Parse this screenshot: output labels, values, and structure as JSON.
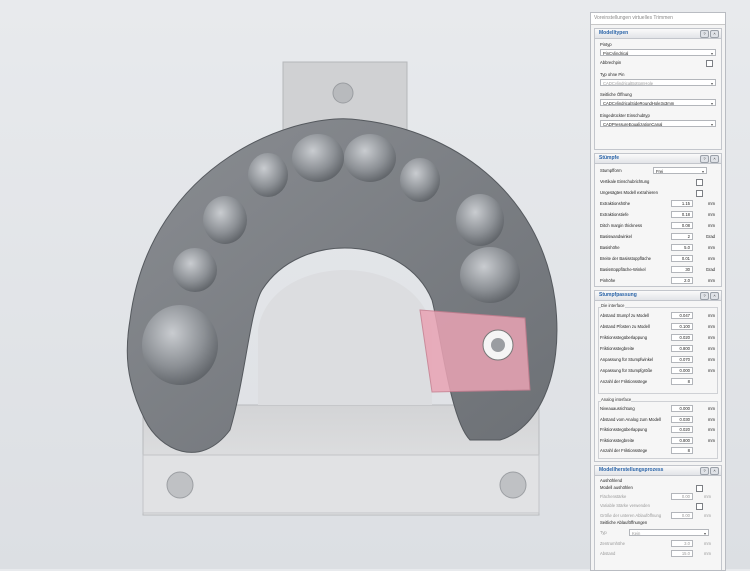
{
  "window_title": "Voreinstellungen virtuelles Trimmen",
  "sections": {
    "modelltypen": {
      "title": "Modelltypen",
      "pintyp_label": "Pintyp",
      "pintyp_value": "PinCylindrical",
      "abbrechpin_label": "Abbrechpin",
      "typ_ohne_pin_label": "Typ ohne Pin",
      "typ_ohne_pin_value": "CADCylindricalBottomHole",
      "seitliche_label": "Seitliche Öffnung",
      "seitliche_value": "CADCylindricalSideRoundHole3x3mm",
      "eingedr_label": "Eingedrückter Einschubtyp",
      "eingedr_value": "CADPressureEqualizationCanal"
    },
    "stuempfe": {
      "title": "Stümpfe",
      "rows": [
        {
          "label": "Stumpfform",
          "value": "Frei",
          "unit": "",
          "kind": "select"
        },
        {
          "label": "Vertikale Einschubrichtung",
          "value": "",
          "unit": "",
          "kind": "check"
        },
        {
          "label": "Ungesägtes Modell extrahieren",
          "value": "",
          "unit": "",
          "kind": "check"
        },
        {
          "label": "Extraktionshöhe",
          "value": "1.15",
          "unit": "mm",
          "kind": "num"
        },
        {
          "label": "Extraktionstiefe",
          "value": "0.18",
          "unit": "mm",
          "kind": "num"
        },
        {
          "label": "Ditch margin thickness",
          "value": "0.08",
          "unit": "mm",
          "kind": "num"
        },
        {
          "label": "Basiswandwinkel",
          "value": "2",
          "unit": "Grad",
          "kind": "num"
        },
        {
          "label": "Basishöhe",
          "value": "5.0",
          "unit": "mm",
          "kind": "num"
        },
        {
          "label": "Breite der Basisstoppfläche",
          "value": "0.01",
          "unit": "mm",
          "kind": "num"
        },
        {
          "label": "Basisstoppfläche-Winkel",
          "value": "30",
          "unit": "Grad",
          "kind": "num"
        },
        {
          "label": "Pinhöhe",
          "value": "2.0",
          "unit": "mm",
          "kind": "num"
        }
      ]
    },
    "stumpfpassung": {
      "title": "Stumpfpassung",
      "die_label": "Die interface",
      "die_rows": [
        {
          "label": "Abstand Stumpf zu Modell",
          "value": "0.047",
          "unit": "mm"
        },
        {
          "label": "Abstand Pfosten zu Modell",
          "value": "0.100",
          "unit": "mm"
        },
        {
          "label": "Friktionsstegüberlappung",
          "value": "0.020",
          "unit": "mm"
        },
        {
          "label": "Friktionsstegbreite",
          "value": "0.800",
          "unit": "mm"
        },
        {
          "label": "Anpassung für Stumpfwinkel",
          "value": "0.070",
          "unit": "mm"
        },
        {
          "label": "Anpassung für Stumpfgröße",
          "value": "0.000",
          "unit": "mm"
        },
        {
          "label": "Anzahl der Friktionsstege",
          "value": "8",
          "unit": ""
        }
      ],
      "analog_label": "Analog interface",
      "analog_rows": [
        {
          "label": "Niveauausrichtung",
          "value": "0.000",
          "unit": "mm"
        },
        {
          "label": "Abstand vom Analog zum Modell",
          "value": "0.030",
          "unit": "mm"
        },
        {
          "label": "Friktionsstegüberlappung",
          "value": "0.020",
          "unit": "mm"
        },
        {
          "label": "Friktionsstegbreite",
          "value": "0.800",
          "unit": "mm"
        },
        {
          "label": "Anzahl der Friktionsstege",
          "value": "8",
          "unit": ""
        }
      ]
    },
    "modellherstellung": {
      "title": "Modellherstellungsprozess",
      "aushoehlend_label": "Aushöhlend",
      "model_aush_label": "Modell aushöhlen",
      "flaechenstaerke_label": "Flächenstärke",
      "flaechenstaerke_value": "0.00",
      "variable_label": "Variable Stärke verwenden",
      "groesse_label": "Größe der unteren Ablauföffnung",
      "groesse_value": "0.00",
      "seitliche_label": "Seitliche Ablauföffnungen",
      "typ_label": "Typ",
      "typ_value": "Kein",
      "zentrum_label": "Zentrumhöhe",
      "zentrum_value": "3.0",
      "abstand_label": "Abstand",
      "abstand_value": "15.0",
      "unit": "mm"
    }
  },
  "colors": {
    "section_title": "#2a64a8",
    "trim_highlight": "#e9a3b4",
    "model_gray": "#8f9296"
  }
}
